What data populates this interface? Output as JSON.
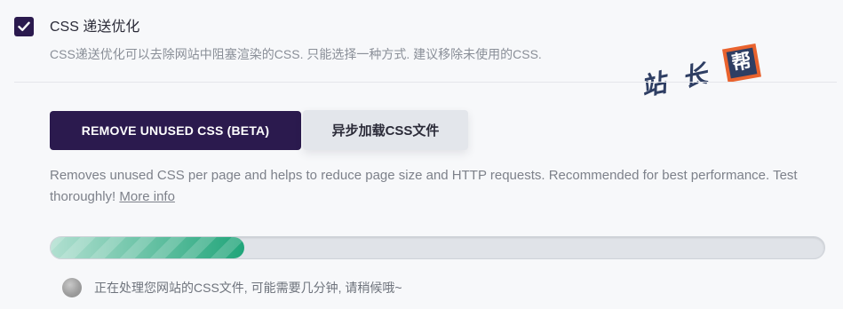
{
  "option": {
    "title": "CSS 递送优化",
    "description": "CSS递送优化可以去除网站中阻塞渲染的CSS. 只能选择一种方式. 建议移除未使用的CSS.",
    "checked": true
  },
  "watermark": {
    "text_left": "站",
    "text_mid": "长",
    "badge": "帮"
  },
  "modes": {
    "remove_label": "REMOVE UNUSED CSS (BETA)",
    "async_label": "异步加载CSS文件",
    "description": "Removes unused CSS per page and helps to reduce page size and HTTP requests. Recommended for best performance. Test thoroughly!",
    "more_link": "More info"
  },
  "progress": {
    "fraction": 0.25
  },
  "status": {
    "text": "正在处理您网站的CSS文件, 可能需要几分钟, 请稍候哦~"
  },
  "colors": {
    "primary": "#2b1a4e",
    "progress": "#21a57a",
    "watermark_blue": "#2e3e63",
    "watermark_orange": "#e9632e"
  }
}
